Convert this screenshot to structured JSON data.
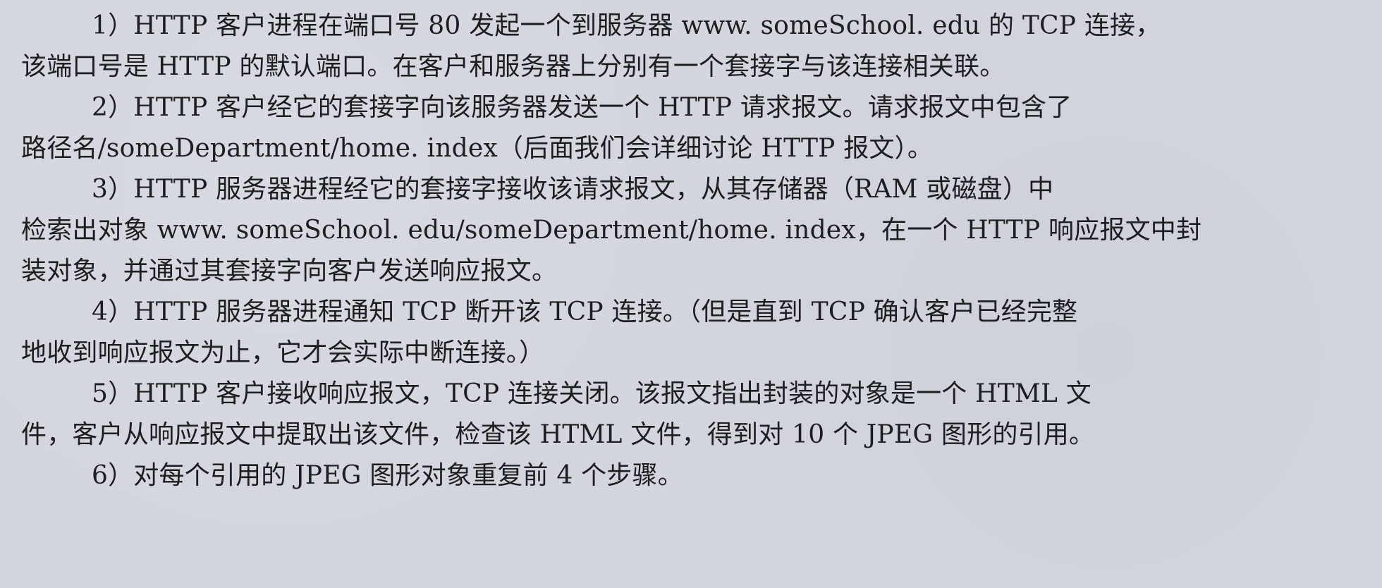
{
  "document": {
    "lines": [
      "1）HTTP 客户进程在端口号 80 发起一个到服务器 www. someSchool. edu 的 TCP 连接，",
      "该端口号是 HTTP 的默认端口。在客户和服务器上分别有一个套接字与该连接相关联。",
      "2）HTTP 客户经它的套接字向该服务器发送一个 HTTP 请求报文。请求报文中包含了",
      "路径名/someDepartment/home. index（后面我们会详细讨论 HTTP 报文）。",
      "3）HTTP 服务器进程经它的套接字接收该请求报文，从其存储器（RAM 或磁盘）中",
      "检索出对象 www. someSchool. edu/someDepartment/home. index，在一个 HTTP 响应报文中封",
      "装对象，并通过其套接字向客户发送响应报文。",
      "4）HTTP 服务器进程通知 TCP 断开该 TCP 连接。（但是直到 TCP 确认客户已经完整",
      "地收到响应报文为止，它才会实际中断连接。）",
      "5）HTTP 客户接收响应报文，TCP 连接关闭。该报文指出封装的对象是一个 HTML 文",
      "件，客户从响应报文中提取出该文件，检查该 HTML 文件，得到对 10 个 JPEG 图形的引用。",
      "6）对每个引用的 JPEG 图形对象重复前 4 个步骤。"
    ]
  }
}
